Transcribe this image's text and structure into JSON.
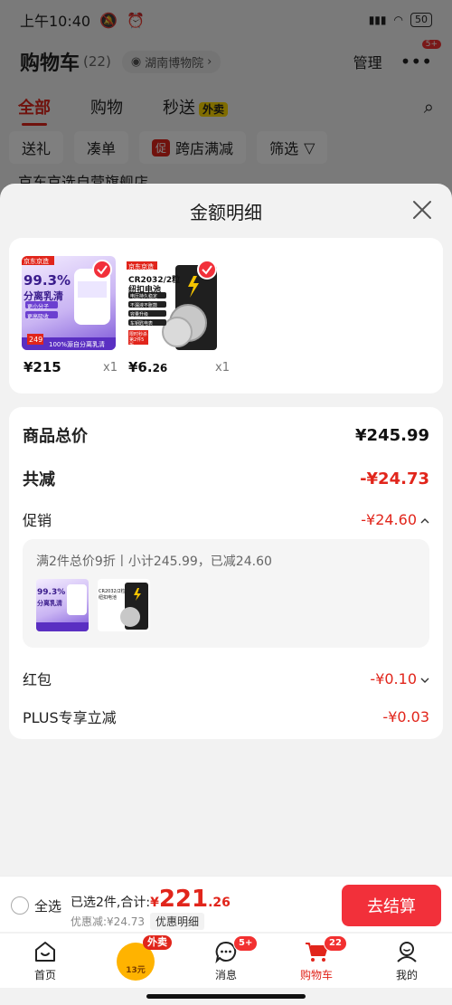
{
  "status": {
    "time": "上午10:40",
    "battery": "50"
  },
  "bg": {
    "cart_title": "购物车",
    "cart_count": "(22)",
    "location": "湖南博物院",
    "manage": "管理",
    "more_badge": "5+",
    "tabs": [
      "全部",
      "购物",
      "秒送"
    ],
    "tab_waimai": "外卖",
    "filters": [
      "送礼",
      "凑单",
      "跨店满减",
      "筛选"
    ],
    "cu_badge": "促",
    "store_peek": "京东京选自营旗舰店"
  },
  "sheet": {
    "title": "金额明细",
    "products": [
      {
        "price_int": "¥215",
        "price_dec": "",
        "qty": "x1",
        "img_tag": "京东京造",
        "img_line1": "99.3%",
        "img_line2": "分离乳清",
        "img_chip1": "更小分子",
        "img_chip2": "更高吸收",
        "img_bottom": "100%源自分离乳清",
        "img_price": "249"
      },
      {
        "price_int": "¥6.",
        "price_dec": "26",
        "qty": "x1",
        "img_tag": "京东京造",
        "img_line1": "CR2032/2粒",
        "img_line2": "纽扣电池",
        "img_chip1": "电压持久稳定",
        "img_chip2": "不漏液不胀鼓",
        "img_chip3": "容量升级",
        "img_chip4": "车钥匙电表",
        "img_bottom": "限时秒杀 第2件5折"
      }
    ],
    "rows": {
      "total_label": "商品总价",
      "total_value": "¥245.99",
      "reduce_label": "共减",
      "reduce_value": "-¥24.73",
      "promo_label": "促销",
      "promo_value": "-¥24.60",
      "promo_desc": "满2件总价9折丨小计245.99，已减24.60",
      "redpacket_label": "红包",
      "redpacket_value": "-¥0.10",
      "plus_label": "PLUS专享立减",
      "plus_value": "-¥0.03"
    }
  },
  "checkout": {
    "select_all": "全选",
    "selected_text": "已选2件,合计:",
    "sum_yen": "¥",
    "sum_int": "221",
    "sum_dec": ".26",
    "discount_text": "优惠减:¥24.73",
    "discount_detail": "优惠明细",
    "checkout_button": "去结算"
  },
  "nav": {
    "items": [
      "首页",
      "",
      "消息",
      "购物车",
      "我的"
    ],
    "waimai_tag": "外卖",
    "waimai_amount": "13元",
    "msg_badge": "5+",
    "cart_badge": "22"
  },
  "colors": {
    "accent": "#e1251b",
    "button": "#f2303a"
  }
}
